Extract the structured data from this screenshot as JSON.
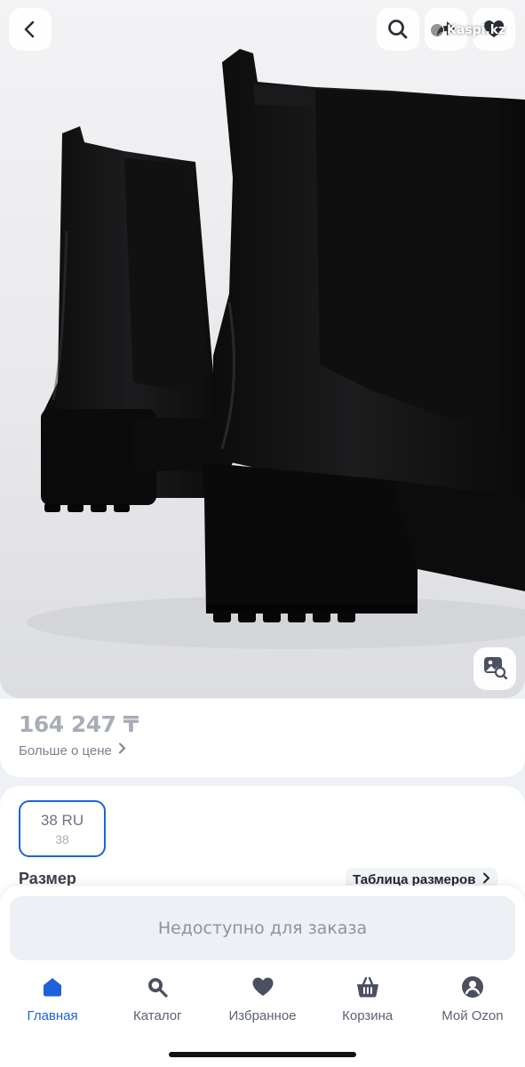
{
  "header": {
    "back_icon": "chevron-left-icon",
    "search_icon": "search-icon",
    "share_icon": "share-arrow-icon",
    "favorite_icon": "heart-icon",
    "watermark": "Kaspi.kz"
  },
  "gallery": {
    "image": "black-chelsea-ankle-boots",
    "visual_search_icon": "image-search-icon"
  },
  "price": {
    "value": "164 247 ₸",
    "more_label": "Больше о цене",
    "more_icon": "chevron-right-icon"
  },
  "size": {
    "selected_label": "38 RU",
    "selected_sub": "38",
    "label": "Размер",
    "table_label": "Таблица размеров",
    "table_icon": "chevron-right-icon"
  },
  "order": {
    "label": "Недоступно для заказа"
  },
  "tabbar": {
    "items": [
      {
        "label": "Главная",
        "icon": "home-icon",
        "active": true
      },
      {
        "label": "Каталог",
        "icon": "search-icon",
        "active": false
      },
      {
        "label": "Избранное",
        "icon": "heart-icon",
        "active": false
      },
      {
        "label": "Корзина",
        "icon": "basket-icon",
        "active": false
      },
      {
        "label": "Мой Ozon",
        "icon": "profile-icon",
        "active": false
      }
    ]
  },
  "colors": {
    "accent": "#1d62d9",
    "price_text": "#a8adb8",
    "muted_text": "#8d93a0"
  }
}
